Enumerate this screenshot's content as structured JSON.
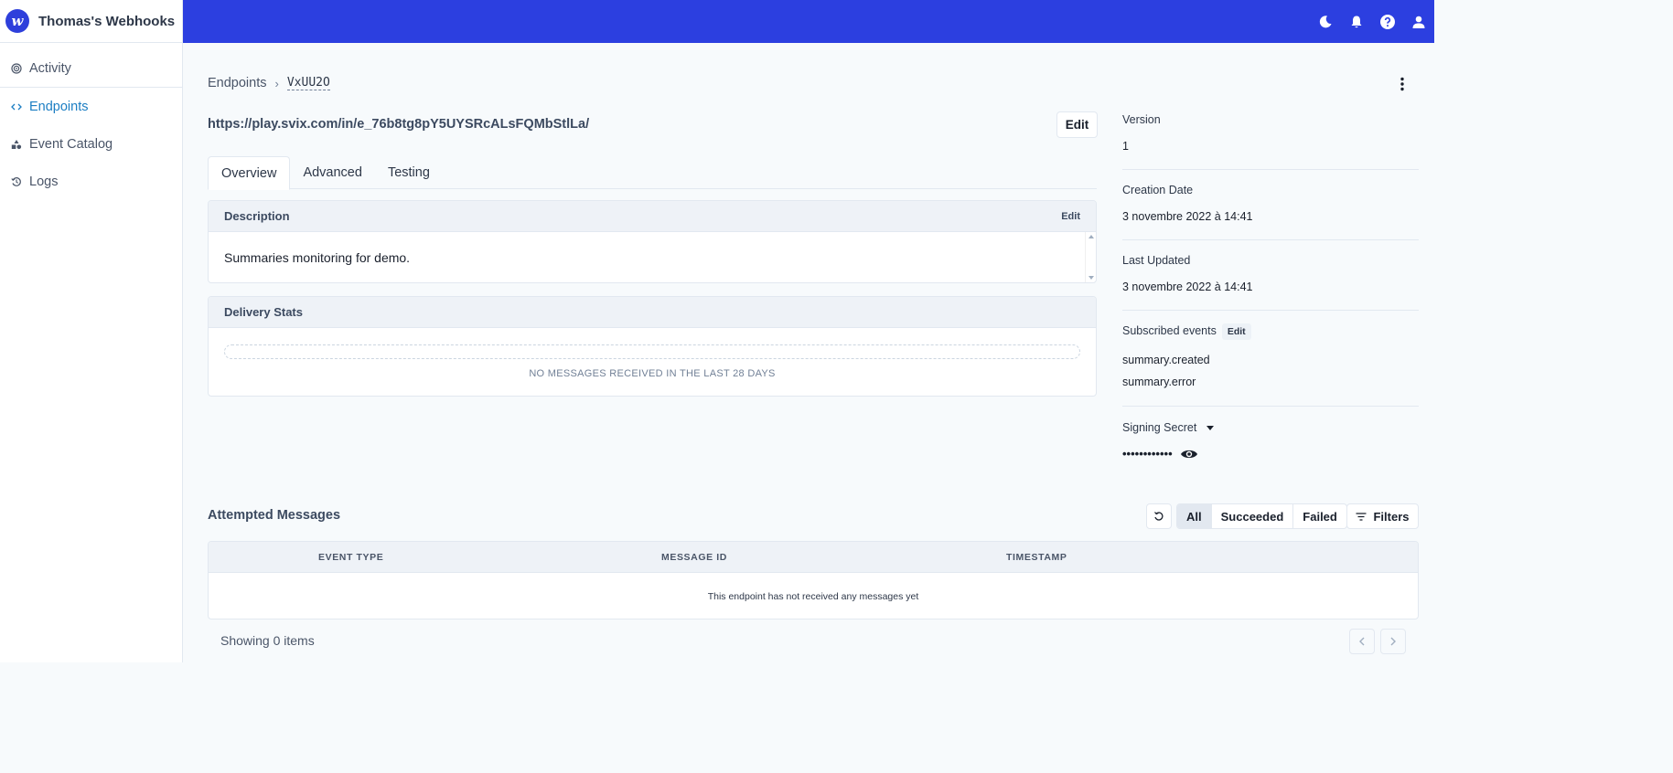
{
  "app": {
    "name": "Thomas's Webhooks",
    "logo_letter": "w"
  },
  "sidebar": {
    "items": [
      {
        "label": "Activity",
        "icon": "activity-icon",
        "active": false
      },
      {
        "label": "Endpoints",
        "icon": "code-icon",
        "active": true
      },
      {
        "label": "Event Catalog",
        "icon": "shapes-icon",
        "active": false
      },
      {
        "label": "Logs",
        "icon": "history-icon",
        "active": false
      }
    ]
  },
  "topbar": {
    "icons": [
      "moon-icon",
      "bell-icon",
      "help-icon",
      "user-icon"
    ],
    "color": "#2c3fe0"
  },
  "breadcrumb": {
    "parent": "Endpoints",
    "current": "VxUU2O"
  },
  "endpoint": {
    "url": "https://play.svix.com/in/e_76b8tg8pY5UYSRcALsFQMbStlLa/",
    "edit_label": "Edit"
  },
  "tabs": [
    {
      "label": "Overview",
      "active": true
    },
    {
      "label": "Advanced",
      "active": false
    },
    {
      "label": "Testing",
      "active": false
    }
  ],
  "description": {
    "title": "Description",
    "edit_label": "Edit",
    "text": "Summaries monitoring for demo."
  },
  "delivery_stats": {
    "title": "Delivery Stats",
    "empty_text": "NO MESSAGES RECEIVED IN THE LAST 28 DAYS"
  },
  "details": {
    "version_label": "Version",
    "version_value": "1",
    "creation_label": "Creation Date",
    "creation_value": "3 novembre 2022 à 14:41",
    "updated_label": "Last Updated",
    "updated_value": "3 novembre 2022 à 14:41",
    "subscribed_label": "Subscribed events",
    "subscribed_edit": "Edit",
    "events": [
      "summary.created",
      "summary.error"
    ],
    "secret_label": "Signing Secret",
    "secret_value": "••••••••••••"
  },
  "attempted": {
    "title": "Attempted Messages",
    "filter_options": [
      {
        "label": "All",
        "active": true
      },
      {
        "label": "Succeeded",
        "active": false
      },
      {
        "label": "Failed",
        "active": false
      }
    ],
    "filters_label": "Filters",
    "columns": [
      "EVENT TYPE",
      "MESSAGE ID",
      "TIMESTAMP"
    ],
    "empty_text": "This endpoint has not received any messages yet",
    "showing": "Showing 0 items"
  }
}
